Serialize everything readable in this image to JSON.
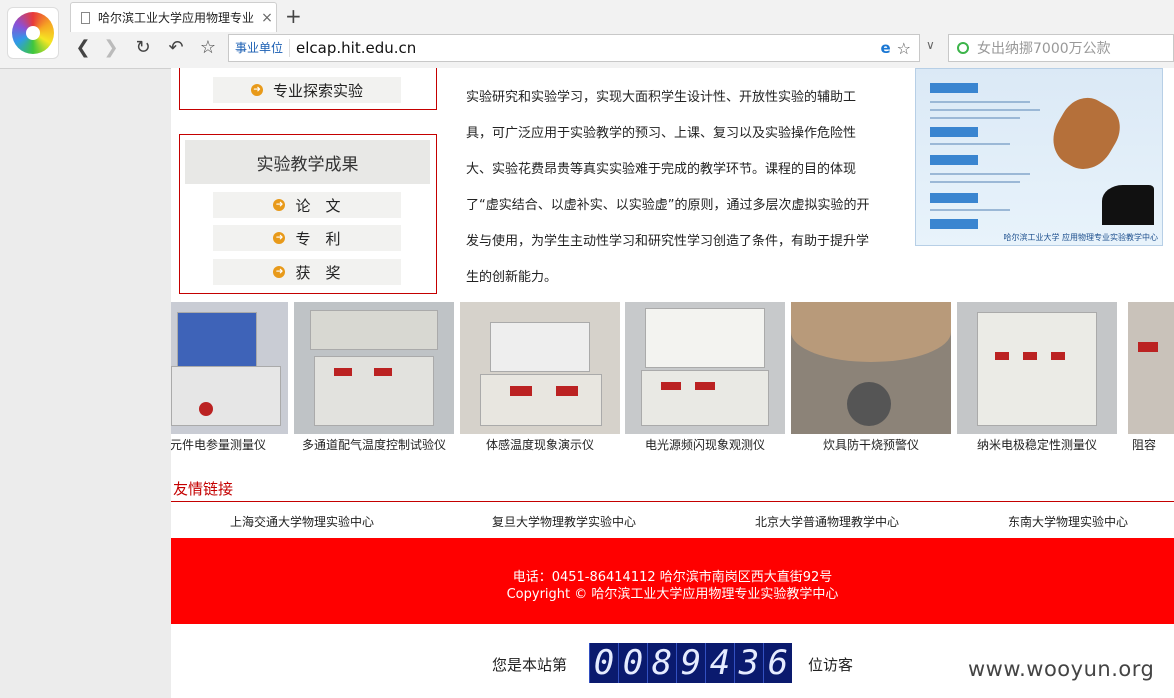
{
  "browser": {
    "tab_title": "哈尔滨工业大学应用物理专业",
    "tab_close": "×",
    "new_tab": "+",
    "url_badge": "事业单位",
    "url": "elcap.hit.edu.cn",
    "search_placeholder": "女出纳挪7000万公款"
  },
  "sidebar": {
    "top_item": "专业探索实验",
    "results_heading": "实验教学成果",
    "results_items": [
      "论　文",
      "专　利",
      "获　奖"
    ]
  },
  "intro_text": "实验研究和实验学习，实现大面积学生设计性、开放性实验的辅助工具，可广泛应用于实验教学的预习、上课、复习以及实验操作危险性大、实验花费昂贵等真实实验难于完成的教学环节。课程的目的体现了“虚实结合、以虚补实、以实验虚”的原则，通过多层次虚拟实验的开发与使用，为学生主动性学习和研究性学习创造了条件，有助于提升学生的创新能力。",
  "poster": {
    "footer": "哈尔滨工业大学 应用物理专业实验教学中心"
  },
  "gallery": [
    {
      "caption": "元件电参量测量仪"
    },
    {
      "caption": "多通道配气温度控制试验仪"
    },
    {
      "caption": "体感温度现象演示仪"
    },
    {
      "caption": "电光源频闪现象观测仪"
    },
    {
      "caption": "炊具防干烧预警仪"
    },
    {
      "caption": "纳米电极稳定性测量仪"
    },
    {
      "caption": "阻容"
    }
  ],
  "friend_links": {
    "title": "友情链接",
    "items": [
      "上海交通大学物理实验中心",
      "复旦大学物理教学实验中心",
      "北京大学普通物理教学中心",
      "东南大学物理实验中心"
    ]
  },
  "footer": {
    "line1": "电话：0451-86414112 哈尔滨市南岗区西大直街92号",
    "line2": "Copyright © 哈尔滨工业大学应用物理专业实验教学中心"
  },
  "visitor": {
    "prefix": "您是本站第",
    "digits": [
      "0",
      "0",
      "8",
      "9",
      "4",
      "3",
      "6"
    ],
    "suffix": "位访客"
  },
  "watermark": "www.wooyun.org",
  "colors": {
    "accent_red": "#c40000",
    "footer_red": "#ff0000",
    "counter_bg": "#0a1a6e"
  }
}
